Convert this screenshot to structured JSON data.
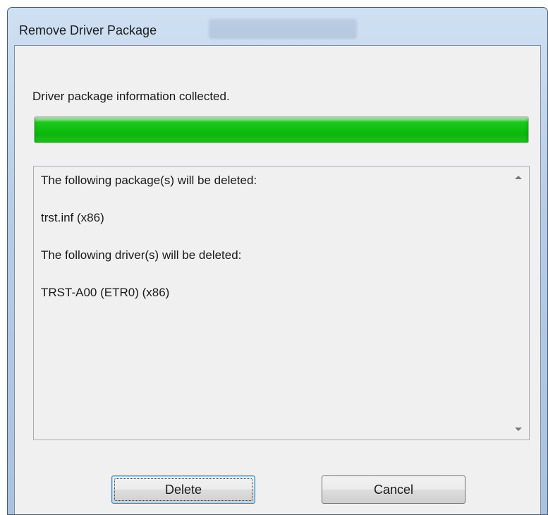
{
  "window": {
    "title": "Remove Driver Package"
  },
  "status": {
    "text": "Driver package information collected.",
    "progress_fraction": 1.0
  },
  "details": {
    "lines": [
      "The following package(s) will be deleted:",
      "trst.inf (x86)",
      "The following driver(s) will be deleted:",
      "TRST-A00 (ETR0) (x86)"
    ]
  },
  "buttons": {
    "delete_label": "Delete",
    "cancel_label": "Cancel"
  },
  "colors": {
    "progress_fill": "#0fbf0f",
    "default_button_border": "#3c7fb1"
  },
  "icons": {
    "scroll_up": "scroll-up-arrow",
    "scroll_down": "scroll-down-arrow"
  }
}
